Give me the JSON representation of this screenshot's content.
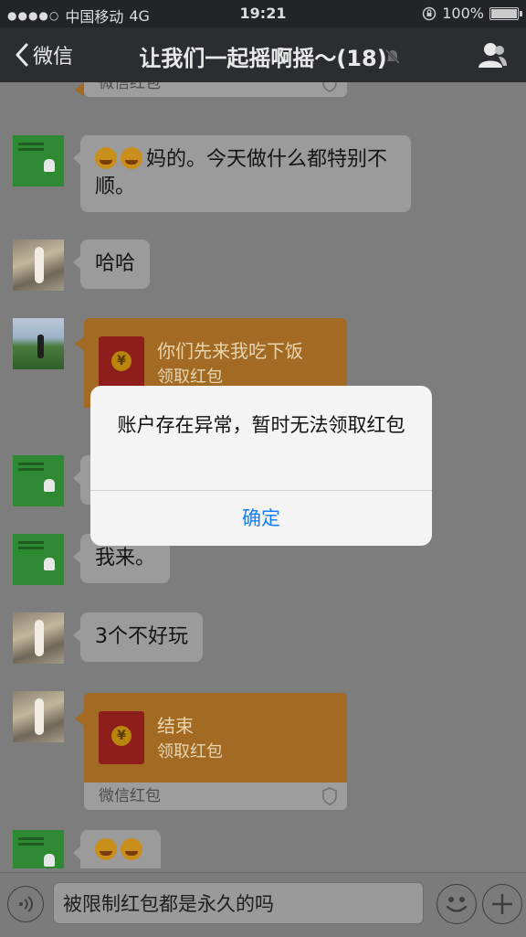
{
  "status_bar": {
    "carrier": "中国移动",
    "network": "4G",
    "time": "19:21",
    "battery": "100%"
  },
  "nav": {
    "back_label": "微信",
    "title": "让我们一起摇啊摇～(18)"
  },
  "messages": [
    {
      "type": "red_packet_footer",
      "footer": "微信红包"
    },
    {
      "type": "text",
      "avatar": "green",
      "text": "妈的。今天做什么都特别不顺。",
      "emoji_count": 2
    },
    {
      "type": "text",
      "avatar": "photo",
      "text": "哈哈"
    },
    {
      "type": "red_packet",
      "avatar": "landscape",
      "title": "你们先来我吃下饭",
      "action": "领取红包"
    },
    {
      "type": "text",
      "avatar": "green",
      "text": "",
      "hidden_by_dialog": true
    },
    {
      "type": "text",
      "avatar": "green",
      "text": "我来。"
    },
    {
      "type": "text",
      "avatar": "photo",
      "text": "3个不好玩"
    },
    {
      "type": "red_packet",
      "avatar": "photo",
      "title": "结束",
      "action": "领取红包",
      "footer": "微信红包"
    },
    {
      "type": "text",
      "avatar": "green",
      "text": "",
      "emoji_count": 2
    }
  ],
  "input": {
    "value": "被限制红包都是永久的吗"
  },
  "dialog": {
    "message": "账户存在异常，暂时无法领取红包",
    "confirm_label": "确定"
  },
  "colors": {
    "dialog_button": "#157efb",
    "red_packet": "#a26a22"
  }
}
